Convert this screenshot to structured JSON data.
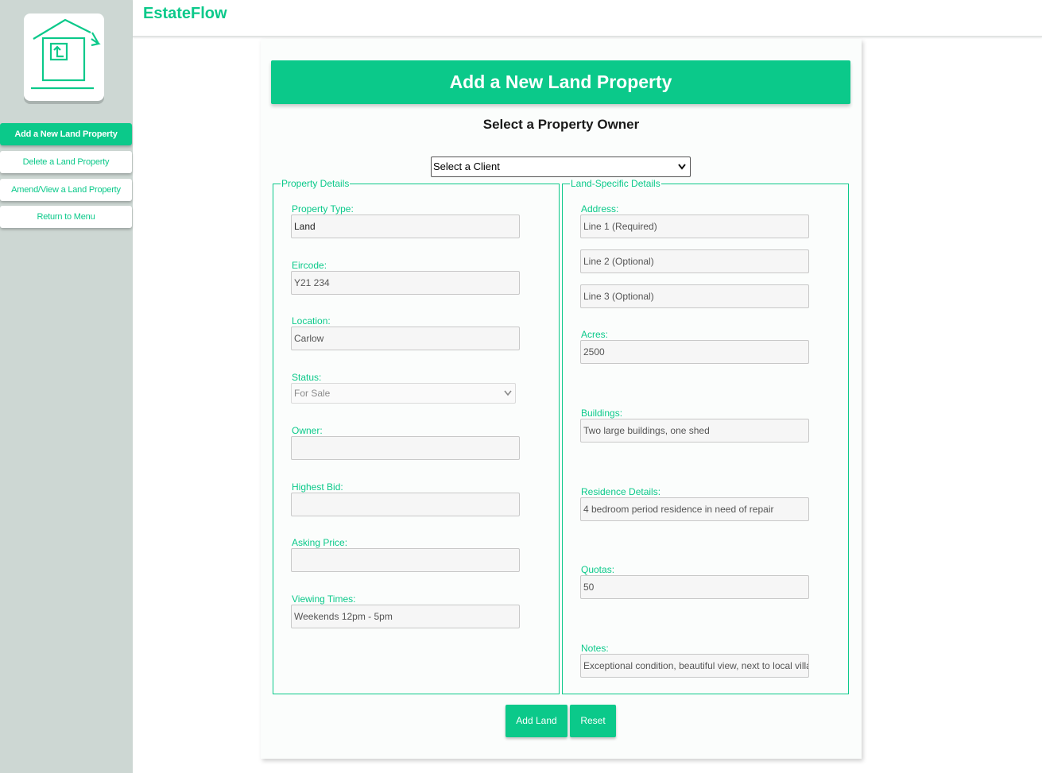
{
  "app": {
    "brand": "EstateFlow"
  },
  "colors": {
    "accent": "#0bc98a",
    "sidebar_bg": "#cdd7d3"
  },
  "logo": {
    "icon": "house-upload-icon"
  },
  "sidebar": {
    "items": [
      {
        "label": "Add a New Land Property",
        "active": true
      },
      {
        "label": "Delete a Land Property"
      },
      {
        "label": "Amend/View a Land Property"
      },
      {
        "label": "Return to Menu"
      }
    ]
  },
  "page": {
    "banner": "Add a New Land Property",
    "owner_heading": "Select a Property Owner",
    "client_select": {
      "value": "Select a Client"
    }
  },
  "property_details": {
    "legend": "Property Details",
    "property_type": {
      "label": "Property Type:",
      "value": "Land"
    },
    "eircode": {
      "label": "Eircode:",
      "placeholder": "Y21 234"
    },
    "location": {
      "label": "Location:",
      "placeholder": "Carlow"
    },
    "status": {
      "label": "Status:",
      "value": "For Sale"
    },
    "owner": {
      "label": "Owner:",
      "value": ""
    },
    "highest_bid": {
      "label": "Highest Bid:",
      "value": ""
    },
    "asking_price": {
      "label": "Asking Price:",
      "value": ""
    },
    "viewing_times": {
      "label": "Viewing Times:",
      "placeholder": "Weekends 12pm - 5pm"
    }
  },
  "land_details": {
    "legend": "Land-Specific Details",
    "address": {
      "label": "Address:",
      "line1": "Line 1 (Required)",
      "line2": "Line 2 (Optional)",
      "line3": "Line 3 (Optional)"
    },
    "acres": {
      "label": "Acres:",
      "placeholder": "2500"
    },
    "buildings": {
      "label": "Buildings:",
      "placeholder": "Two large buildings, one shed"
    },
    "residence": {
      "label": "Residence Details:",
      "placeholder": "4 bedroom period residence in need of repair"
    },
    "quotas": {
      "label": "Quotas:",
      "placeholder": "50"
    },
    "notes": {
      "label": "Notes:",
      "placeholder": "Exceptional condition, beautiful view, next to local villa"
    }
  },
  "actions": {
    "add": "Add Land",
    "reset": "Reset"
  }
}
